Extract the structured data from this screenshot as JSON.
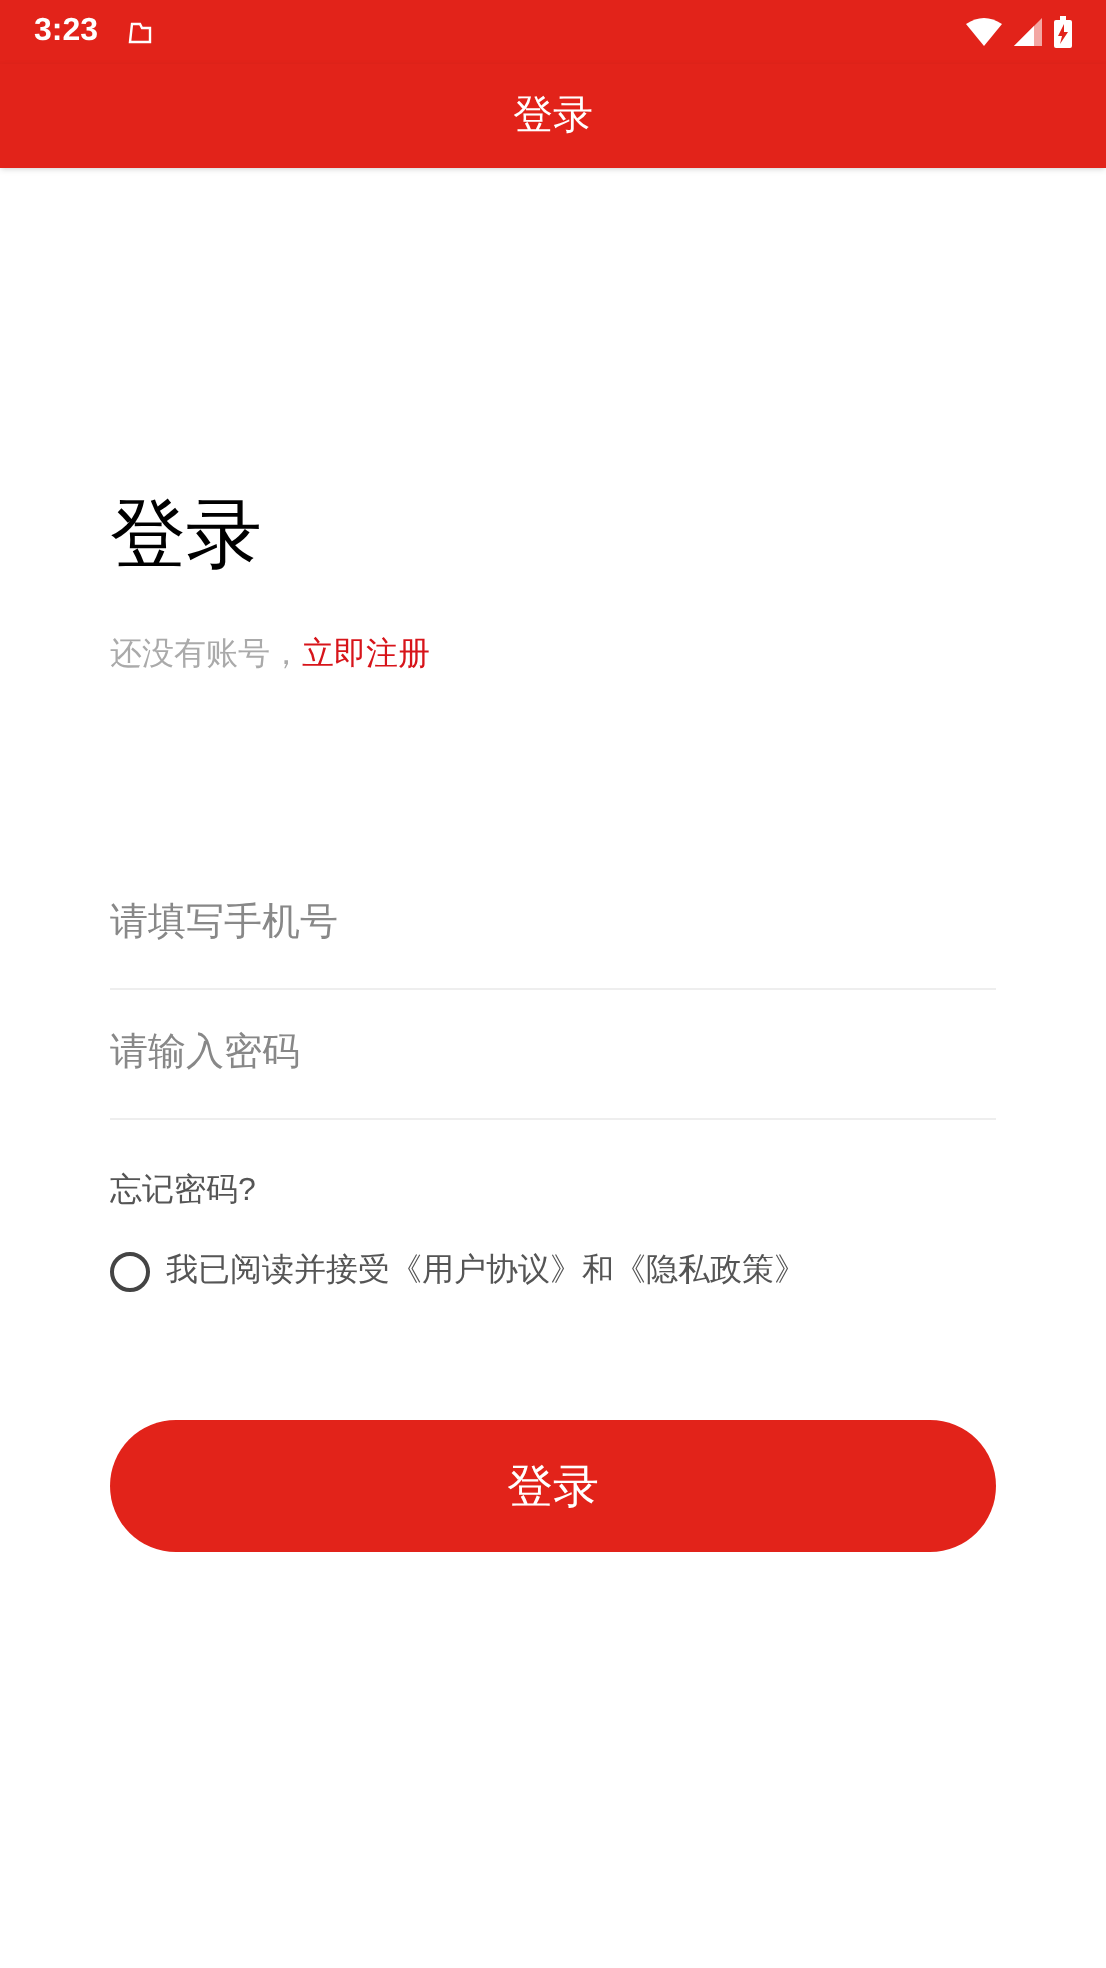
{
  "status_bar": {
    "time": "3:23"
  },
  "app_bar": {
    "title": "登录"
  },
  "heading": "登录",
  "register_prompt": {
    "text": "还没有账号，",
    "link": "立即注册"
  },
  "fields": [
    {
      "placeholder": "请填写手机号"
    },
    {
      "placeholder": "请输入密码"
    }
  ],
  "forgot_password": "忘记密码?",
  "agreement": {
    "checked": false,
    "text": "我已阅读并接受《用户协议》和《隐私政策》"
  },
  "login_button": "登录"
}
